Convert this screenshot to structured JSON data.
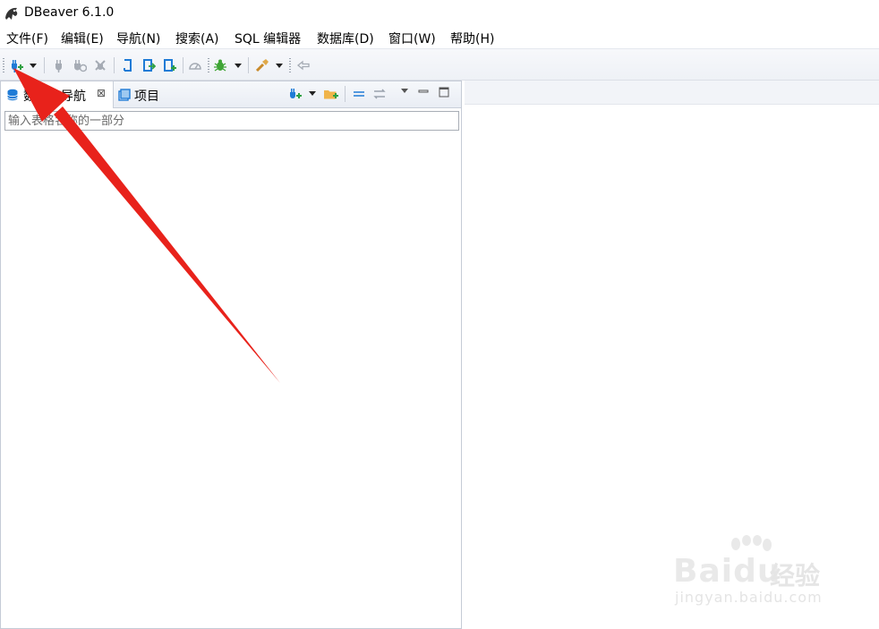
{
  "window": {
    "title": "DBeaver 6.1.0"
  },
  "menu": {
    "items": [
      "文件(F)",
      "编辑(E)",
      "导航(N)",
      "搜索(A)",
      "SQL 编辑器",
      "数据库(D)",
      "窗口(W)",
      "帮助(H)"
    ]
  },
  "toolbar": {
    "icons": [
      "new-connection-icon",
      "dropdown-icon",
      "connect-icon",
      "disconnect-icon",
      "invalidate-icon",
      "commit-icon",
      "rollback-icon",
      "transaction-icon",
      "performance-icon",
      "debug-icon",
      "dropdown-icon",
      "tools-icon",
      "dropdown-icon",
      "back-icon"
    ]
  },
  "navigator": {
    "tabs": [
      {
        "label": "数据库导航",
        "close": "⊠"
      },
      {
        "label": "项目"
      }
    ],
    "filter_placeholder": "输入表格名称的一部分"
  },
  "watermark": {
    "brand": "Baidu",
    "cn": "经验",
    "url": "jingyan.baidu.com"
  },
  "colors": {
    "accent": "#1f7bd6",
    "annotation_arrow": "#e8221b",
    "tab_bg": "#e9edf4"
  }
}
